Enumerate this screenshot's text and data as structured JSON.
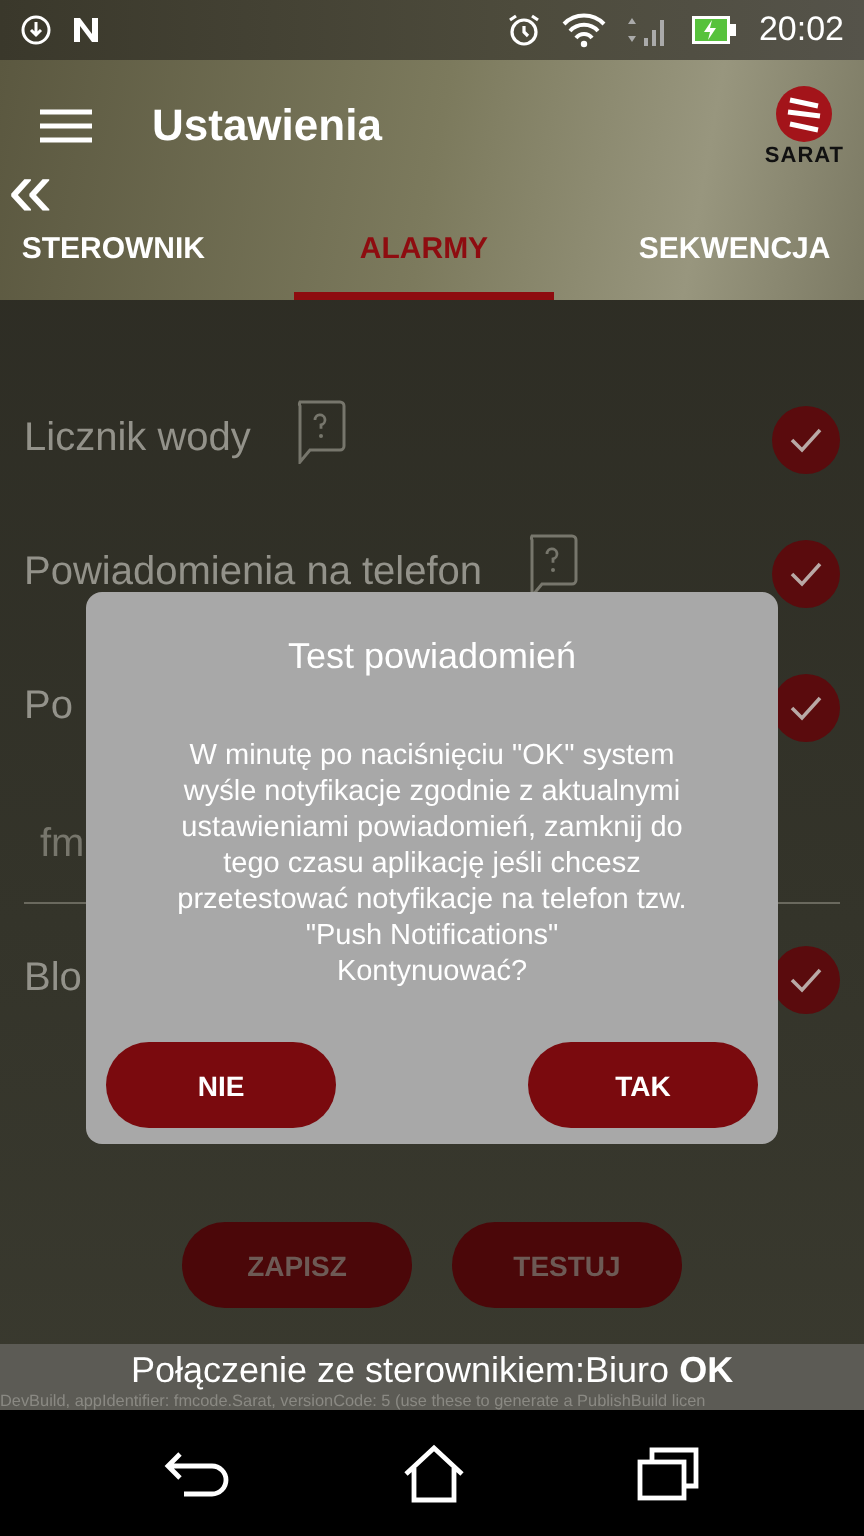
{
  "status_bar": {
    "time": "20:02"
  },
  "app_bar": {
    "title": "Ustawienia",
    "logo_text": "SARAT",
    "back_icon": "«"
  },
  "tabs": [
    {
      "label": "STEROWNIK",
      "selected": false
    },
    {
      "label": "ALARMY",
      "selected": true
    },
    {
      "label": "SEKWENCJA",
      "selected": false
    }
  ],
  "rows": [
    {
      "kind": "toggle",
      "label": "Licznik wody",
      "help": true,
      "checked": true
    },
    {
      "kind": "toggle",
      "label": "Powiadomienia na telefon",
      "help": true,
      "checked": true
    },
    {
      "kind": "toggle",
      "label": "Po",
      "help": false,
      "checked": true
    },
    {
      "kind": "field",
      "value": "fm"
    },
    {
      "kind": "toggle",
      "label": "Blo",
      "help": false,
      "checked": true
    }
  ],
  "buttons": [
    "ZAPISZ",
    "TESTUJ"
  ],
  "connection": "Połączenie ze sterownikiem:Biuro **OK**",
  "debug_line": "DevBuild, appIdentifier: fmcode.Sarat, versionCode: 5 (use these to generate a PublishBuild licen",
  "dialog": {
    "title": "Test powiadomień",
    "message": "W minutę po naciśnięciu \"OK\" system wyśle notyfikacje zgodnie z aktualnymi ustawieniami powiadomień, zamknij do tego czasu aplikację jeśli chcesz przetestować notyfikacje na telefon tzw.\n\"Push Notifications\"\nKontynuować?",
    "buttons": [
      "NIE",
      "TAK"
    ]
  }
}
